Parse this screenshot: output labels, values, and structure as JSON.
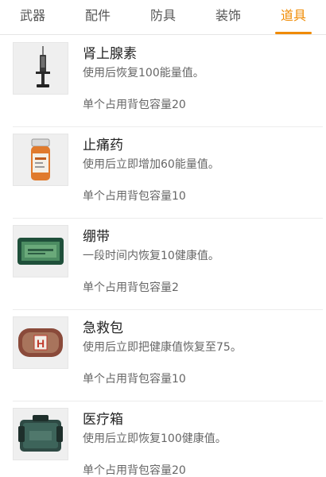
{
  "tabs": [
    {
      "label": "武器",
      "active": false
    },
    {
      "label": "配件",
      "active": false
    },
    {
      "label": "防具",
      "active": false
    },
    {
      "label": "装饰",
      "active": false
    },
    {
      "label": "道具",
      "active": true
    }
  ],
  "accent_color": "#f08a00",
  "items": [
    {
      "name": "肾上腺素",
      "desc": "使用后恢复100能量值。",
      "capacity": "单个占用背包容量20",
      "icon": "syringe-icon"
    },
    {
      "name": "止痛药",
      "desc": "使用后立即增加60能量值。",
      "capacity": "单个占用背包容量10",
      "icon": "pill-bottle-icon"
    },
    {
      "name": "绷带",
      "desc": "一段时间内恢复10健康值。",
      "capacity": "单个占用背包容量2",
      "icon": "bandage-icon"
    },
    {
      "name": "急救包",
      "desc": "使用后立即把健康值恢复至75。",
      "capacity": "单个占用背包容量10",
      "icon": "first-aid-kit-icon"
    },
    {
      "name": "医疗箱",
      "desc": "使用后立即恢复100健康值。",
      "capacity": "单个占用背包容量20",
      "icon": "medical-box-icon"
    }
  ]
}
